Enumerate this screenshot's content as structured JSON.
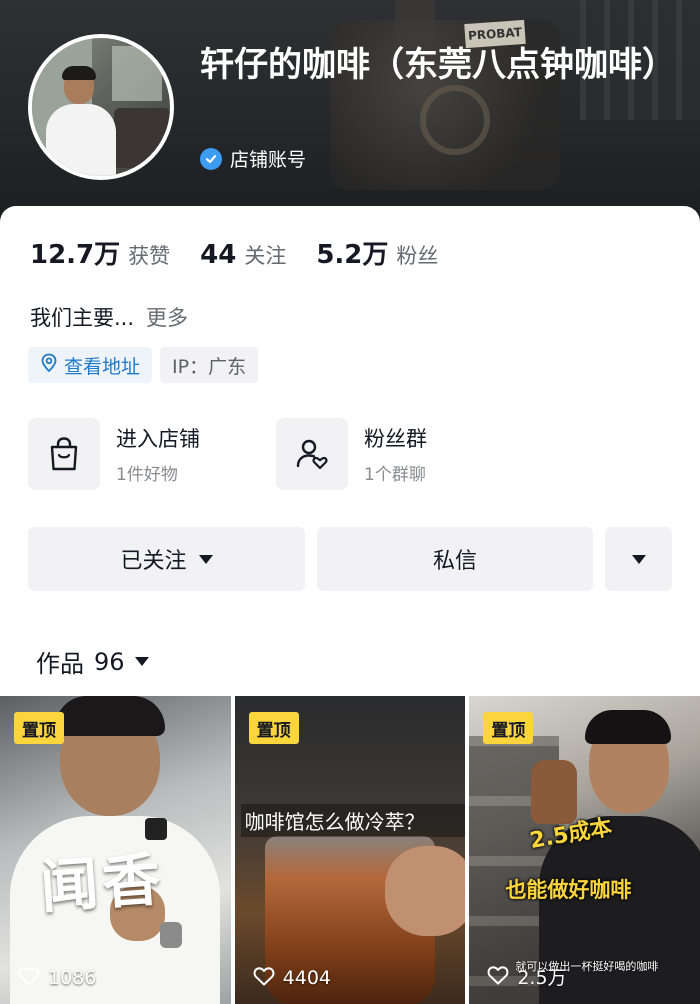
{
  "header": {
    "shop_name": "轩仔的咖啡（东莞八点钟咖啡）",
    "verified_label": "店铺账号",
    "background_sign": "PROBAT"
  },
  "stats": [
    {
      "value": "12.7万",
      "label": "获赞"
    },
    {
      "value": "44",
      "label": "关注"
    },
    {
      "value": "5.2万",
      "label": "粉丝"
    }
  ],
  "bio": {
    "text": "我们主要...",
    "more_label": "更多"
  },
  "chips": {
    "location": "查看地址",
    "ip": "IP：广东"
  },
  "entries": {
    "shop": {
      "title": "进入店铺",
      "subtitle": "1件好物"
    },
    "fans": {
      "title": "粉丝群",
      "subtitle": "1个群聊"
    }
  },
  "actions": {
    "follow_label": "已关注",
    "message_label": "私信"
  },
  "works_tab": {
    "label": "作品",
    "count": "96"
  },
  "videos": [
    {
      "pin_label": "置顶",
      "likes": "1086",
      "overlay": "闻香"
    },
    {
      "pin_label": "置顶",
      "likes": "4404",
      "overlay": "咖啡馆怎么做冷萃？"
    },
    {
      "pin_label": "置顶",
      "likes": "2.5万",
      "overlay_line1": "2.5成本",
      "overlay_line2": "也能做好咖啡",
      "caption": "就可以做出一杯挺好喝的咖啡"
    }
  ],
  "colors": {
    "verify_blue": "#3d9bf2",
    "location_blue": "#1f7ac9",
    "pin_yellow": "#fad53b",
    "button_gray": "#f2f2f4"
  },
  "icons": [
    "verified-check-icon",
    "location-pin-icon",
    "shopping-bag-icon",
    "fans-group-icon",
    "caret-down-icon",
    "heart-icon"
  ]
}
